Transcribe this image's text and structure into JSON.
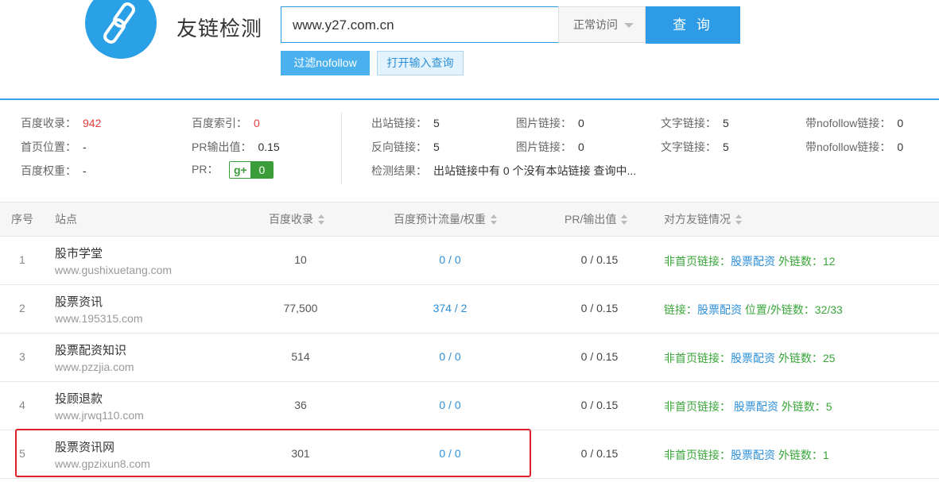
{
  "header": {
    "title": "友链检测",
    "search_value": "www.y27.com.cn",
    "mode_label": "正常访问",
    "query_label": "查 询",
    "filter_nofollow_label": "过滤nofollow",
    "open_input_label": "打开输入查询"
  },
  "stats": {
    "baidu_index_label": "百度收录：",
    "baidu_index_value": "942",
    "baidu_suoyin_label": "百度索引：",
    "baidu_suoyin_value": "0",
    "homepage_pos_label": "首页位置：",
    "homepage_pos_value": "-",
    "pr_output_label": "PR输出值：",
    "pr_output_value": "0.15",
    "baidu_weight_label": "百度权重：",
    "baidu_weight_value": "-",
    "pr_label": "PR：",
    "pr_badge_g": "g+",
    "pr_badge_value": "0",
    "outbound_label": "出站链接：",
    "outbound_value": "5",
    "image_links_label_1": "图片链接：",
    "image_links_value_1": "0",
    "text_links_label_1": "文字链接：",
    "text_links_value_1": "5",
    "nofollow_label_1": "带nofollow链接：",
    "nofollow_value_1": "0",
    "reverse_label": "反向链接：",
    "reverse_value": "5",
    "image_links_label_2": "图片链接：",
    "image_links_value_2": "0",
    "text_links_label_2": "文字链接：",
    "text_links_value_2": "5",
    "nofollow_label_2": "带nofollow链接：",
    "nofollow_value_2": "0",
    "result_label": "检测结果：",
    "result_value": "出站链接中有 0 个没有本站链接 查询中..."
  },
  "table": {
    "headers": {
      "index": "序号",
      "site": "站点",
      "baidu": "百度收录",
      "flow": "百度预计流量/权重",
      "pr": "PR/输出值",
      "status": "对方友链情况"
    },
    "rows": [
      {
        "index": "1",
        "name": "股市学堂",
        "domain": "www.gushixuetang.com",
        "baidu": "10",
        "flow": "0 / 0",
        "pr": "0 / 0.15",
        "link_prefix": "非首页链接：",
        "link_kw": "股票配资",
        "link_suffix": " 外链数：12"
      },
      {
        "index": "2",
        "name": "股票资讯",
        "domain": "www.195315.com",
        "baidu": "77,500",
        "flow": "374 / 2",
        "pr": "0 / 0.15",
        "link_prefix": "链接：",
        "link_kw": "股票配资",
        "link_suffix": "  位置/外链数：32/33"
      },
      {
        "index": "3",
        "name": "股票配资知识",
        "domain": "www.pzzjia.com",
        "baidu": "514",
        "flow": "0 / 0",
        "pr": "0 / 0.15",
        "link_prefix": "非首页链接：",
        "link_kw": "股票配资",
        "link_suffix": " 外链数：25"
      },
      {
        "index": "4",
        "name": "投顾退款",
        "domain": "www.jrwq110.com",
        "baidu": "36",
        "flow": "0 / 0",
        "pr": "0 / 0.15",
        "link_prefix": "非首页链接： ",
        "link_kw": "股票配资",
        "link_suffix": " 外链数：5"
      },
      {
        "index": "5",
        "name": "股票资讯网",
        "domain": "www.gpzixun8.com",
        "baidu": "301",
        "flow": "0 / 0",
        "pr": "0 / 0.15",
        "link_prefix": "非首页链接：",
        "link_kw": "股票配资",
        "link_suffix": " 外链数：1"
      }
    ]
  },
  "colors": {
    "accent": "#2d9be6",
    "red": "#e23a3a",
    "green": "#3aa53a",
    "highlight": "#e0202a"
  }
}
